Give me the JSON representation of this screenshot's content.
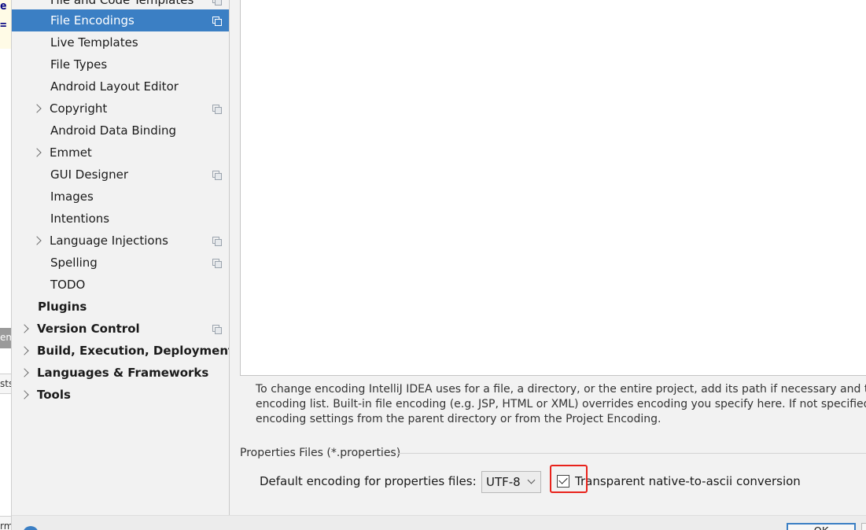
{
  "background": {
    "editor_fragments": [
      "e",
      "="
    ],
    "tab_fragments": [
      "em",
      "sts",
      "rm"
    ]
  },
  "sidebar": {
    "items": [
      {
        "label": "File and Code Templates",
        "level": 2,
        "expandable": false,
        "icon": "copy-icon"
      },
      {
        "label": "File Encodings",
        "level": 2,
        "expandable": false,
        "icon": "copy-icon",
        "selected": true
      },
      {
        "label": "Live Templates",
        "level": 2,
        "expandable": false
      },
      {
        "label": "File Types",
        "level": 2,
        "expandable": false
      },
      {
        "label": "Android Layout Editor",
        "level": 2,
        "expandable": false
      },
      {
        "label": "Copyright",
        "level": 2,
        "expandable": true,
        "icon": "copy-icon"
      },
      {
        "label": "Android Data Binding",
        "level": 2,
        "expandable": false
      },
      {
        "label": "Emmet",
        "level": 2,
        "expandable": true
      },
      {
        "label": "GUI Designer",
        "level": 2,
        "expandable": false,
        "icon": "copy-icon"
      },
      {
        "label": "Images",
        "level": 2,
        "expandable": false
      },
      {
        "label": "Intentions",
        "level": 2,
        "expandable": false
      },
      {
        "label": "Language Injections",
        "level": 2,
        "expandable": true,
        "icon": "copy-icon"
      },
      {
        "label": "Spelling",
        "level": 2,
        "expandable": false,
        "icon": "copy-icon"
      },
      {
        "label": "TODO",
        "level": 2,
        "expandable": false
      },
      {
        "label": "Plugins",
        "level": 1,
        "expandable": false,
        "bold": true
      },
      {
        "label": "Version Control",
        "level": 1,
        "expandable": true,
        "bold": true,
        "icon": "copy-icon"
      },
      {
        "label": "Build, Execution, Deployment",
        "level": 1,
        "expandable": true,
        "bold": true
      },
      {
        "label": "Languages & Frameworks",
        "level": 1,
        "expandable": true,
        "bold": true
      },
      {
        "label": "Tools",
        "level": 1,
        "expandable": true,
        "bold": true
      }
    ]
  },
  "main": {
    "help_lines": [
      "To change encoding IntelliJ IDEA uses for a file, a directory, or the entire project, add its path if necessary and then s",
      "encoding list. Built-in file encoding (e.g. JSP, HTML or XML) overrides encoding you specify here. If not specified, file",
      "encoding settings from the parent directory or from the Project Encoding."
    ],
    "properties_group_title": "Properties Files (*.properties)",
    "default_encoding_label": "Default encoding for properties files:",
    "default_encoding_value": "UTF-8",
    "transparent_conversion_label": "Transparent native-to-ascii conversion",
    "transparent_conversion_checked": true,
    "highlight_color": "#e8221b"
  },
  "footer": {
    "help_glyph": "?",
    "ok_label": "OK"
  },
  "colors": {
    "selection": "#3b7fc4",
    "background": "#f2f2f2"
  }
}
